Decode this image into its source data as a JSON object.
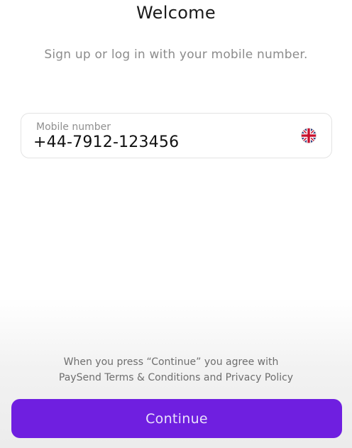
{
  "header": {
    "title": "Welcome",
    "subtitle": "Sign up or log in with your mobile number."
  },
  "phone_field": {
    "label": "Mobile number",
    "value": "+44-7912-123456",
    "country_flag_icon": "uk-flag-icon"
  },
  "legal": {
    "line1": "When you press “Continue” you agree with",
    "line2": "PaySend Terms & Conditions and Privacy Policy"
  },
  "continue_button": {
    "label": "Continue",
    "color": "#6f1fe0"
  }
}
